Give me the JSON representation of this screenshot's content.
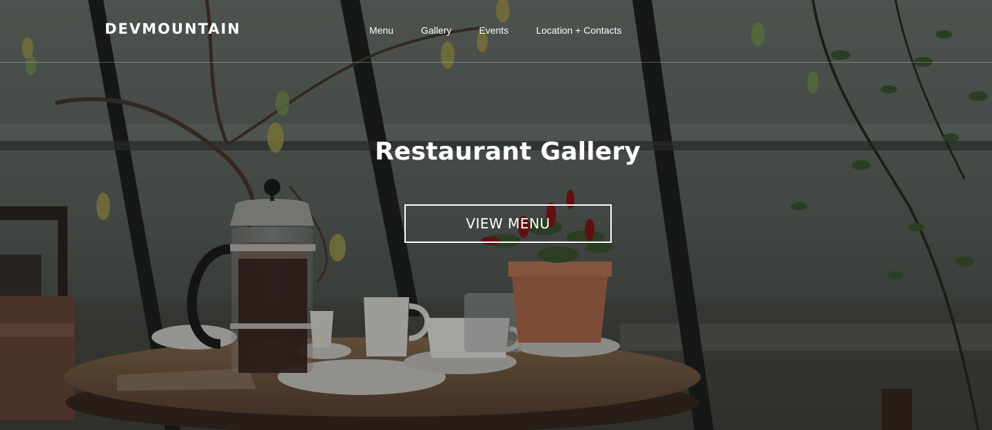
{
  "header": {
    "brand": "DEVMOUNTAIN",
    "nav": [
      {
        "label": "Menu"
      },
      {
        "label": "Gallery"
      },
      {
        "label": "Events"
      },
      {
        "label": "Location + Contacts"
      }
    ]
  },
  "hero": {
    "title": "Restaurant Gallery",
    "cta_label": "VIEW MENU",
    "overlay_color": "#000000"
  }
}
